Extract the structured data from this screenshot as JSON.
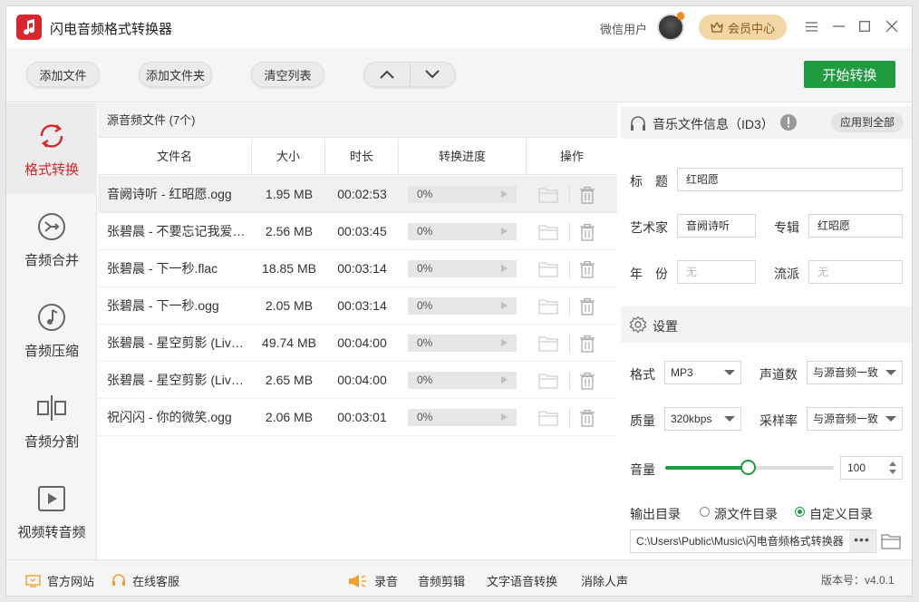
{
  "app": {
    "title": "闪电音频格式转换器",
    "user_name": "微信用户",
    "vip_label": "会员中心"
  },
  "toolbar": {
    "add_file": "添加文件",
    "add_folder": "添加文件夹",
    "clear_list": "清空列表",
    "start": "开始转换"
  },
  "sidebar": {
    "items": [
      {
        "label": "格式转换",
        "icon": "refresh-icon",
        "active": true
      },
      {
        "label": "音频合并",
        "icon": "merge-icon"
      },
      {
        "label": "音频压缩",
        "icon": "music-note-icon"
      },
      {
        "label": "音频分割",
        "icon": "split-icon"
      },
      {
        "label": "视频转音频",
        "icon": "video-play-icon"
      }
    ]
  },
  "file_panel": {
    "header": "源音频文件 (7个)",
    "columns": [
      "文件名",
      "大小",
      "时长",
      "转换进度",
      "操作"
    ],
    "rows": [
      {
        "name": "音阙诗听 - 红昭愿.ogg",
        "size": "1.95 MB",
        "duration": "00:02:53",
        "progress": "0%"
      },
      {
        "name": "张碧晨 - 不要忘记我爱你.flac",
        "size": "2.56 MB",
        "duration": "00:03:45",
        "progress": "0%"
      },
      {
        "name": "张碧晨 - 下一秒.flac",
        "size": "18.85 MB",
        "duration": "00:03:14",
        "progress": "0%"
      },
      {
        "name": "张碧晨 - 下一秒.ogg",
        "size": "2.05 MB",
        "duration": "00:03:14",
        "progress": "0%"
      },
      {
        "name": "张碧晨 - 星空剪影 (Live).flac",
        "size": "49.74 MB",
        "duration": "00:04:00",
        "progress": "0%"
      },
      {
        "name": "张碧晨 - 星空剪影 (Live).ogg",
        "size": "2.65 MB",
        "duration": "00:04:00",
        "progress": "0%"
      },
      {
        "name": "祝闪闪 - 你的微笑.ogg",
        "size": "2.06 MB",
        "duration": "00:03:01",
        "progress": "0%"
      }
    ]
  },
  "id3": {
    "header": "音乐文件信息（ID3）",
    "apply_all": "应用到全部",
    "title_label": "标　题",
    "title_value": "红昭愿",
    "artist_label": "艺术家",
    "artist_value": "音阙诗听",
    "album_label": "专辑",
    "album_value": "红昭愿",
    "year_label": "年　份",
    "year_placeholder": "无",
    "genre_label": "流派",
    "genre_placeholder": "无"
  },
  "settings": {
    "header": "设置",
    "format_label": "格式",
    "format_value": "MP3",
    "channels_label": "声道数",
    "channels_value": "与源音频一致",
    "quality_label": "质量",
    "quality_value": "320kbps",
    "samplerate_label": "采样率",
    "samplerate_value": "与源音频一致",
    "volume_label": "音量",
    "volume_value": "100",
    "volume_level": 0.5,
    "output_label": "输出目录",
    "output_source": "源文件目录",
    "output_custom": "自定义目录",
    "output_path": "C:\\Users\\Public\\Music\\闪电音频格式转换器",
    "more": "•••"
  },
  "statusbar": {
    "website": "官方网站",
    "service": "在线客服",
    "record": "录音",
    "edit": "音频剪辑",
    "tts": "文字语音转换",
    "vocal": "消除人声",
    "version": "版本号：v4.0.1"
  },
  "colors": {
    "accent": "#1e9c3f",
    "brand": "#d9252b",
    "vip": "#f3d6a6"
  }
}
